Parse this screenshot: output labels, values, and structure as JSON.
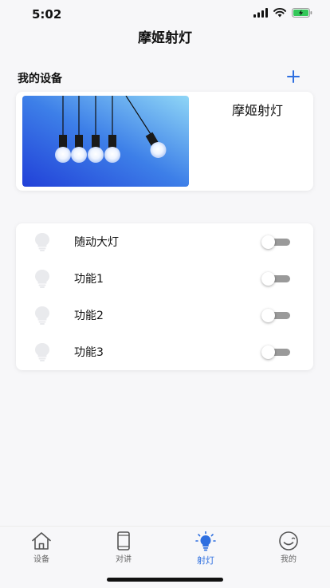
{
  "status_bar": {
    "time": "5:02"
  },
  "nav": {
    "title": "摩姬射灯"
  },
  "devices_section": {
    "title": "我的设备"
  },
  "device": {
    "name": "摩姬射灯"
  },
  "functions": [
    {
      "label": "随动大灯",
      "on": false
    },
    {
      "label": "功能1",
      "on": false
    },
    {
      "label": "功能2",
      "on": false
    },
    {
      "label": "功能3",
      "on": false
    }
  ],
  "tabs": [
    {
      "label": "设备",
      "icon": "home-icon",
      "active": false
    },
    {
      "label": "对讲",
      "icon": "phone-icon",
      "active": false
    },
    {
      "label": "射灯",
      "icon": "lightbulb-icon",
      "active": true
    },
    {
      "label": "我的",
      "icon": "smile-icon",
      "active": false
    }
  ],
  "colors": {
    "accent": "#2e6fe0",
    "toggle_off": "#9a9a9a",
    "background": "#f7f7f9"
  }
}
